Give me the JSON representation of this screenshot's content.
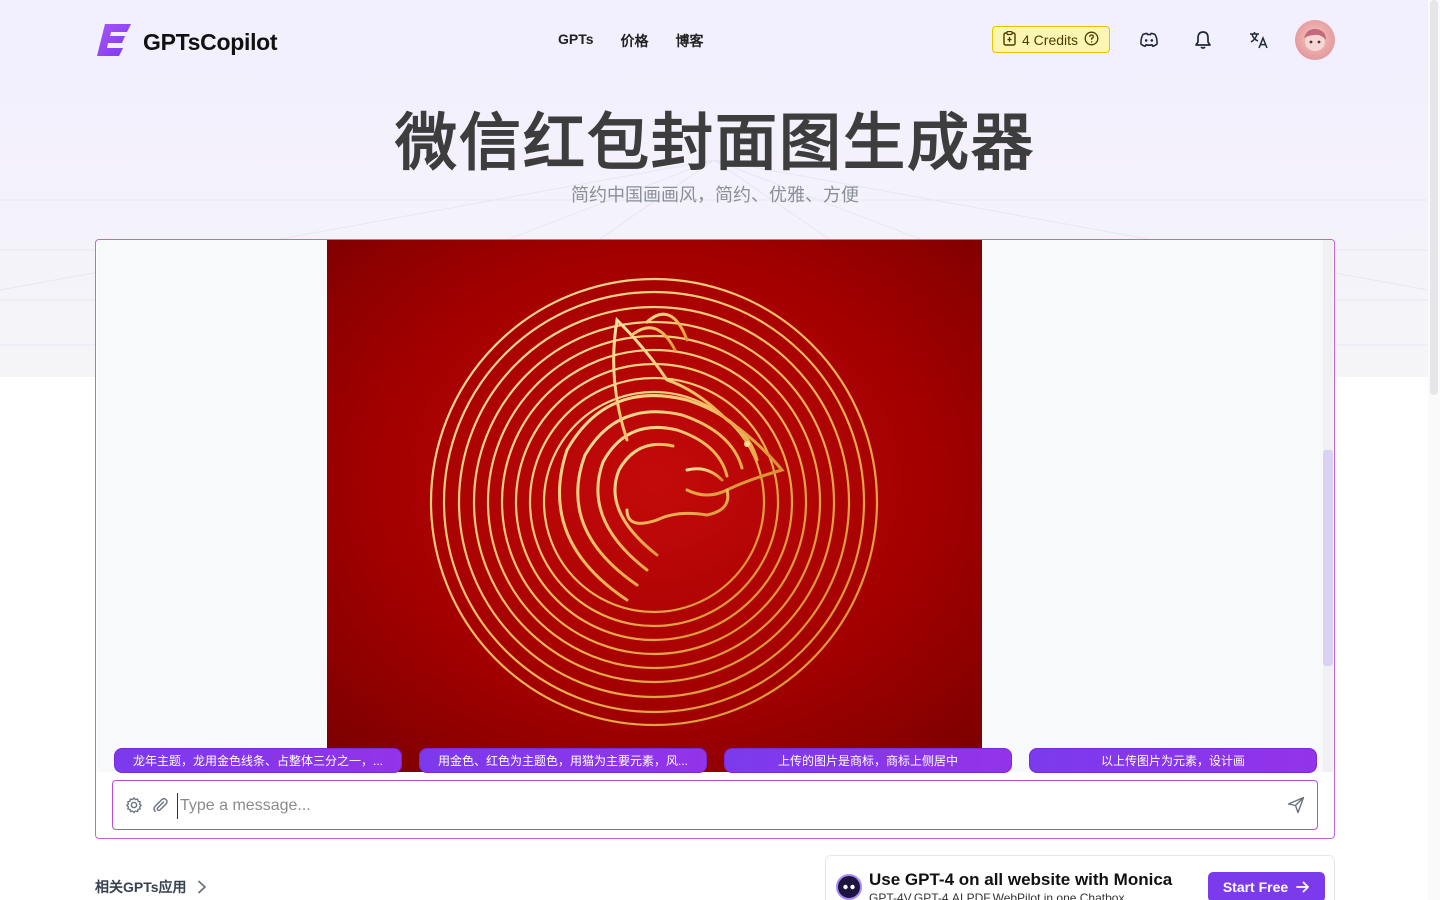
{
  "app": {
    "name": "GPTsCopilot"
  },
  "nav": {
    "gpts": "GPTs",
    "pricing": "价格",
    "blog": "博客"
  },
  "credits": {
    "label": "4 Credits"
  },
  "hero": {
    "title": "微信红包封面图生成器",
    "subtitle": "简约中国画画风，简约、优雅、方便"
  },
  "suggestions": [
    "龙年主题，龙用金色线条、占整体三分之一，...",
    "用金色、红色为主题色，用猫为主要元素，风...",
    "上传的图片是商标，商标上侧居中",
    "以上传图片为元素，设计画"
  ],
  "input": {
    "placeholder": "Type a message..."
  },
  "related": {
    "label": "相关GPTs应用"
  },
  "promo": {
    "title": "Use GPT-4 on all website with Monica",
    "subtitle": "GPT-4V,GPT-4,AI PDF,WebPilot in one Chatbox",
    "button": "Start Free"
  },
  "colors": {
    "accent": "#7c3aed",
    "frame_border": "#c364d8",
    "credits_bg": "#fdf6b2",
    "dragon_bg": "#b00000",
    "gold": "#f2c572"
  },
  "icons": [
    "logo-icon",
    "credits-icon",
    "help-icon",
    "discord-icon",
    "bell-icon",
    "translate-icon",
    "settings-icon",
    "paperclip-icon",
    "send-icon",
    "chevron-right-icon",
    "monica-logo-icon",
    "arrow-right-icon"
  ]
}
